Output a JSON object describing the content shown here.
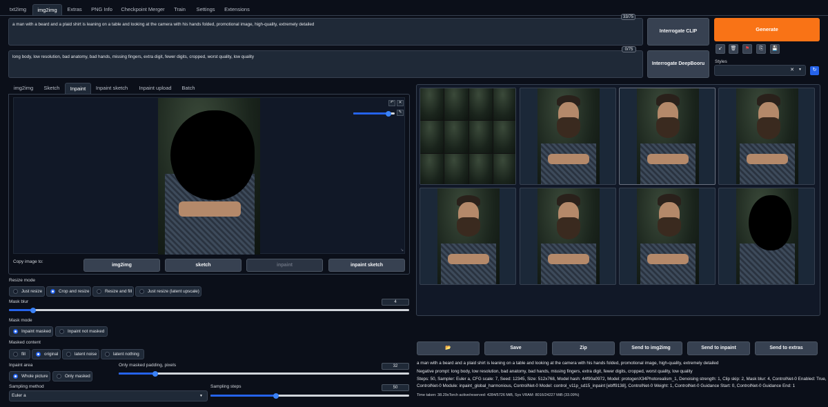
{
  "top_tabs": [
    "txt2img",
    "img2img",
    "Extras",
    "PNG Info",
    "Checkpoint Merger",
    "Train",
    "Settings",
    "Extensions"
  ],
  "prompt": {
    "text": "a man with a beard and a plaid shirt is leaning on a table and looking at the camera with his hands folded, promotional image, high-quality, extremely detailed",
    "counter": "33/75"
  },
  "negative": {
    "text": "long body, low resolution, bad anatomy, bad hands, missing fingers, extra digit, fewer digits, cropped, worst quality, low quality",
    "counter": "0/75"
  },
  "buttons": {
    "interrogate_clip": "Interrogate CLIP",
    "interrogate_deepbooru": "Interrogate DeepBooru",
    "generate": "Generate"
  },
  "styles_label": "Styles",
  "sub_tabs": [
    "img2img",
    "Sketch",
    "Inpaint",
    "Inpaint sketch",
    "Inpaint upload",
    "Batch"
  ],
  "copy_image": {
    "label": "Copy image to:",
    "targets": [
      "img2img",
      "sketch",
      "inpaint",
      "inpaint sketch"
    ]
  },
  "resize_mode": {
    "label": "Resize mode",
    "options": [
      "Just resize",
      "Crop and resize",
      "Resize and fill",
      "Just resize (latent upscale)"
    ],
    "selected": "Crop and resize"
  },
  "mask_blur": {
    "label": "Mask blur",
    "value": "4",
    "fraction": 0.06
  },
  "mask_mode": {
    "label": "Mask mode",
    "options": [
      "Inpaint masked",
      "Inpaint not masked"
    ],
    "selected": "Inpaint masked"
  },
  "masked_content": {
    "label": "Masked content",
    "options": [
      "fill",
      "original",
      "latent noise",
      "latent nothing"
    ],
    "selected": "original"
  },
  "inpaint_area": {
    "label": "Inpaint area",
    "options": [
      "Whole picture",
      "Only masked"
    ],
    "selected": "Whole picture"
  },
  "padding": {
    "label": "Only masked padding, pixels",
    "value": "32",
    "fraction": 0.125
  },
  "sampling_method": {
    "label": "Sampling method",
    "value": "Euler a"
  },
  "sampling_steps": {
    "label": "Sampling steps",
    "value": "50",
    "fraction": 0.33
  },
  "output_buttons": [
    "Save",
    "Zip",
    "Send to img2img",
    "Send to inpaint",
    "Send to extras"
  ],
  "output_info": {
    "line1": "a man with a beard and a plaid shirt is leaning on a table and looking at the camera with his hands folded, promotional image, high-quality, extremely detailed",
    "line2": "Negative prompt: long body, low resolution, bad anatomy, bad hands, missing fingers, extra digit, fewer digits, cropped, worst quality, low quality",
    "line3": "Steps: 50, Sampler: Euler a, CFG scale: 7, Seed: 12345, Size: 512x768, Model hash: 44f90a0972, Model: protogenX34Photorealism_1, Denoising strength: 1, Clip skip: 2, Mask blur: 4, ControlNet-0 Enabled: True,",
    "line4": "ControlNet-0 Module: inpaint_global_harmonious, ControlNet-0 Model: control_v11p_sd15_inpaint [ebff9138], ControlNet-0 Weight: 1, ControlNet-0 Guidance Start: 0, ControlNet-0 Guidance End: 1",
    "time": "Time taken: 38.29sTorch active/reserved: 4284/5726 MiB, Sys VRAM: 8016/24227 MiB (33.09%)"
  },
  "brush_size_fraction": 0.85,
  "colors": {
    "accent": "#f97316",
    "slider": "#2563eb",
    "bg": "#0b0f19"
  }
}
